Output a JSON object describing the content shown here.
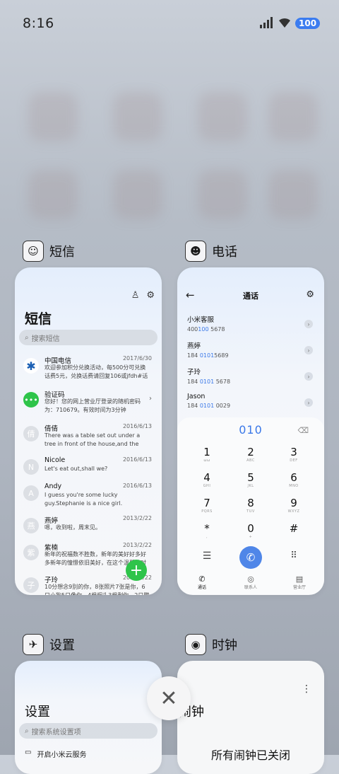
{
  "status_bar": {
    "time": "8:16",
    "battery": "100"
  },
  "apps": [
    {
      "name": "短信",
      "icon": "messages-app-icon"
    },
    {
      "name": "电话",
      "icon": "phone-app-icon"
    },
    {
      "name": "设置",
      "icon": "settings-app-icon"
    },
    {
      "name": "时钟",
      "icon": "clock-app-icon"
    }
  ],
  "sms": {
    "title": "短信",
    "search_placeholder": "搜索短信",
    "messages": [
      {
        "avatar": "",
        "name": "中国电信",
        "date": "2017/6/30",
        "preview": "欢迎参加积分兑换活动，每500分可兑换话费5元，兑换话费请回复106或jfdh#话费"
      },
      {
        "avatar": "",
        "name": "验证码",
        "date": "",
        "preview": "您好！您的网上营业厅登录的随机密码为：710679。有效时间为3分钟"
      },
      {
        "avatar": "倩",
        "name": "倩倩",
        "date": "2016/6/13",
        "preview": "There was a table set out under a tree in front of the house,and the March Hare an"
      },
      {
        "avatar": "N",
        "name": "Nicole",
        "date": "2016/6/13",
        "preview": "Let's eat out,shall we?"
      },
      {
        "avatar": "A",
        "name": "Andy",
        "date": "2016/6/13",
        "preview": "I guess you're some lucky guy.Stephanie is a nice girl."
      },
      {
        "avatar": "燕",
        "name": "燕婷",
        "date": "2013/2/22",
        "preview": "嗯，收到啦，周末见。"
      },
      {
        "avatar": "紫",
        "name": "紫楠",
        "date": "2013/2/22",
        "preview": "新年的祝福数不胜数，新年的美好好多好多新年的憧憬依旧美好，在这个温馨的时刻"
      },
      {
        "avatar": "子",
        "name": "子玲",
        "date": "2013/2/22",
        "preview": "10分想念9别的你，8张照片7张是你，6只小狗5只像你，4根烟头3根剩你，2只鹦鹉"
      }
    ]
  },
  "phone": {
    "title": "通话",
    "contacts": [
      {
        "name": "小米客服",
        "pre": "400",
        "hl": "100",
        "post": " 5678"
      },
      {
        "name": "燕婷",
        "pre": "184 ",
        "hl": "0101",
        "post": "5689"
      },
      {
        "name": "子玲",
        "pre": "184 ",
        "hl": "0101",
        "post": " 5678"
      },
      {
        "name": "Jason",
        "pre": "184 ",
        "hl": "0101",
        "post": " 0029"
      }
    ],
    "dialed": "010",
    "keys": [
      {
        "d": "1",
        "l": "ωω"
      },
      {
        "d": "2",
        "l": "ABC"
      },
      {
        "d": "3",
        "l": "DEF"
      },
      {
        "d": "4",
        "l": "GHI"
      },
      {
        "d": "5",
        "l": "JKL"
      },
      {
        "d": "6",
        "l": "MNO"
      },
      {
        "d": "7",
        "l": "PQRS"
      },
      {
        "d": "8",
        "l": "TUV"
      },
      {
        "d": "9",
        "l": "WXYZ"
      },
      {
        "d": "*",
        "l": ","
      },
      {
        "d": "0",
        "l": "+"
      },
      {
        "d": "#",
        "l": ""
      }
    ],
    "tabs": [
      "通话",
      "联系人",
      "营业厅"
    ]
  },
  "settings": {
    "title": "设置",
    "search_placeholder": "搜索系统设置项",
    "first_item": "开启小米云服务"
  },
  "clock": {
    "title": "闹钟",
    "empty_text": "所有闹钟已关闭"
  }
}
